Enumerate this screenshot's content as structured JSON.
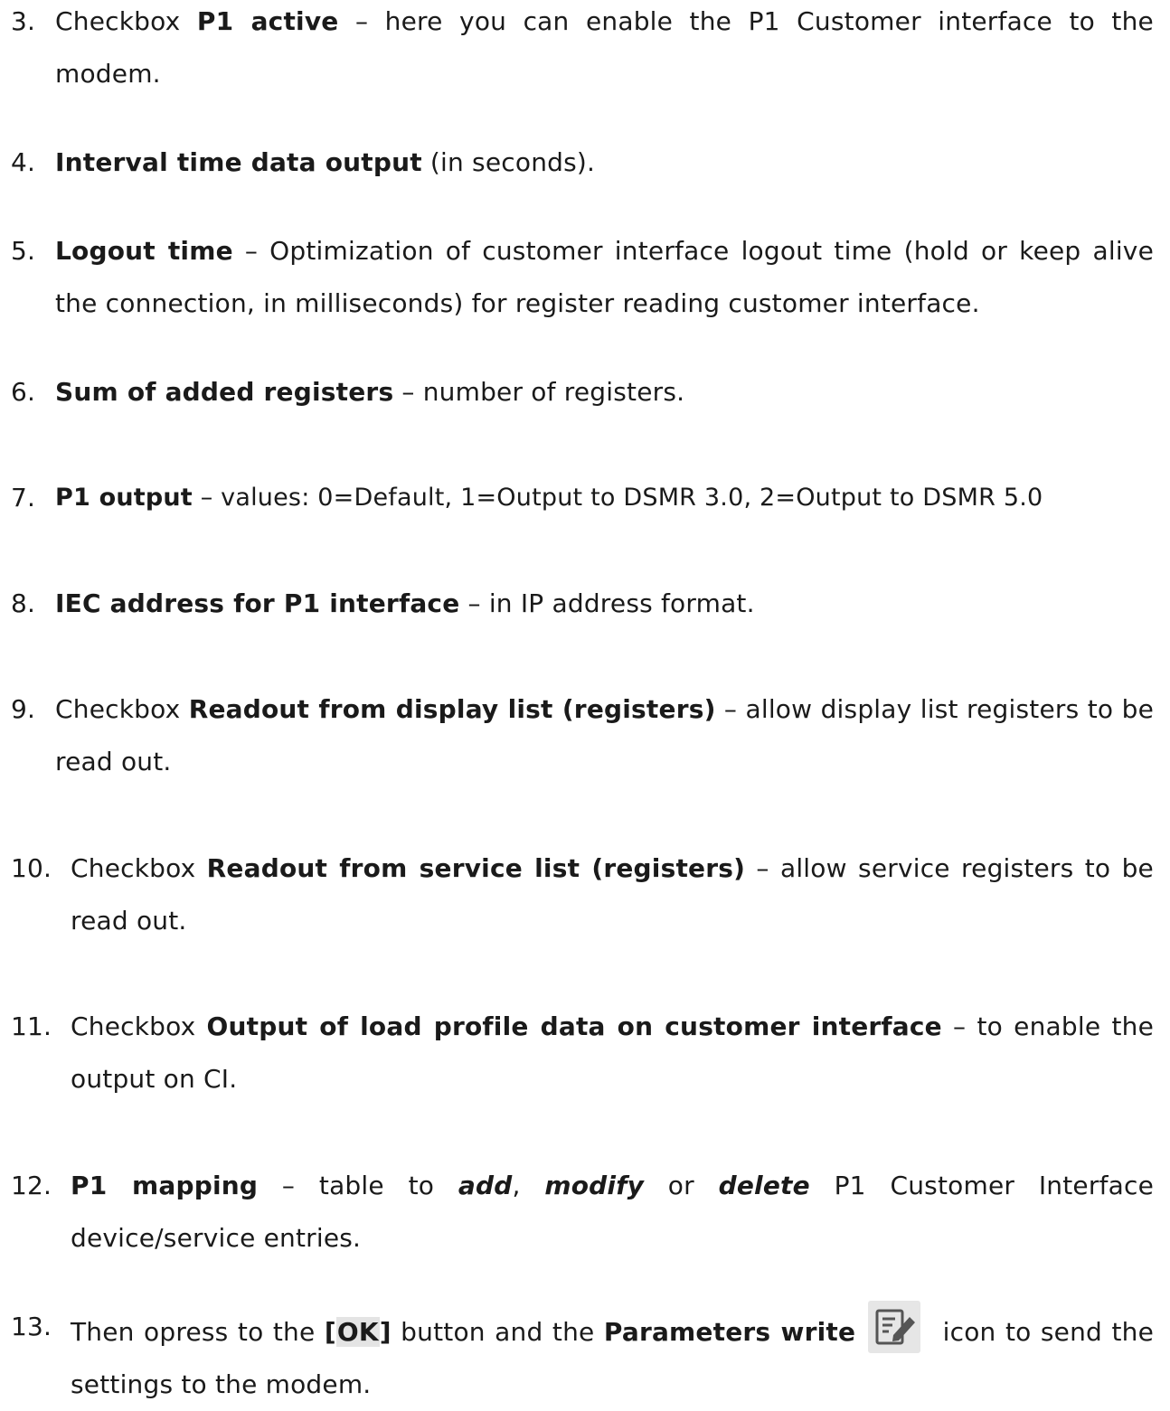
{
  "items": [
    {
      "num": "3.",
      "t1": "Checkbox ",
      "b1": "P1 active",
      "t2": " – here you can enable the P1 Customer interface to the modem."
    },
    {
      "num": "4.",
      "b1": "Interval time data output",
      "t1": " (in seconds)."
    },
    {
      "num": "5.",
      "b1": "Logout time",
      "t1": " – Optimization of customer interface logout time (hold or keep alive the connection, in milliseconds) for register reading customer interface."
    },
    {
      "num": "6.",
      "b1": "Sum of added registers",
      "t1": " – number of registers."
    },
    {
      "num": "7.",
      "b1": "P1 output",
      "t1": " – values: 0=Default, 1=Output to DSMR 3.0, 2=Output to DSMR 5.0"
    },
    {
      "num": "8.",
      "b1": "IEC address for P1 interface",
      "t1": " – in IP address format."
    },
    {
      "num": "9.",
      "t1": "Checkbox ",
      "b1": "Readout from display list (registers)",
      "t2": " – allow display list registers to be read out."
    },
    {
      "num": "10.",
      "t1": "Checkbox ",
      "b1": "Readout from service list (registers)",
      "t2": " – allow service registers to be read out."
    },
    {
      "num": "11.",
      "t1": "Checkbox ",
      "b1": "Output of load profile data on customer interface",
      "t2": " – to enable the output on CI."
    },
    {
      "num": "12.",
      "b1": "P1 mapping",
      "t1": " – table to ",
      "bi1": "add",
      "t2": ", ",
      "bi2": "modify",
      "t3": " or ",
      "bi3": "delete",
      "t4": " P1 Customer Interface device/service entries."
    },
    {
      "num": "13.",
      "t1": "Then opress to the ",
      "ok_open": "[",
      "ok_label": "OK",
      "ok_close": "]",
      "t2": "  button and the ",
      "b1": "Parameters write",
      "icon": "edit-document-icon",
      "t3": " icon to send the settings to the modem."
    }
  ]
}
